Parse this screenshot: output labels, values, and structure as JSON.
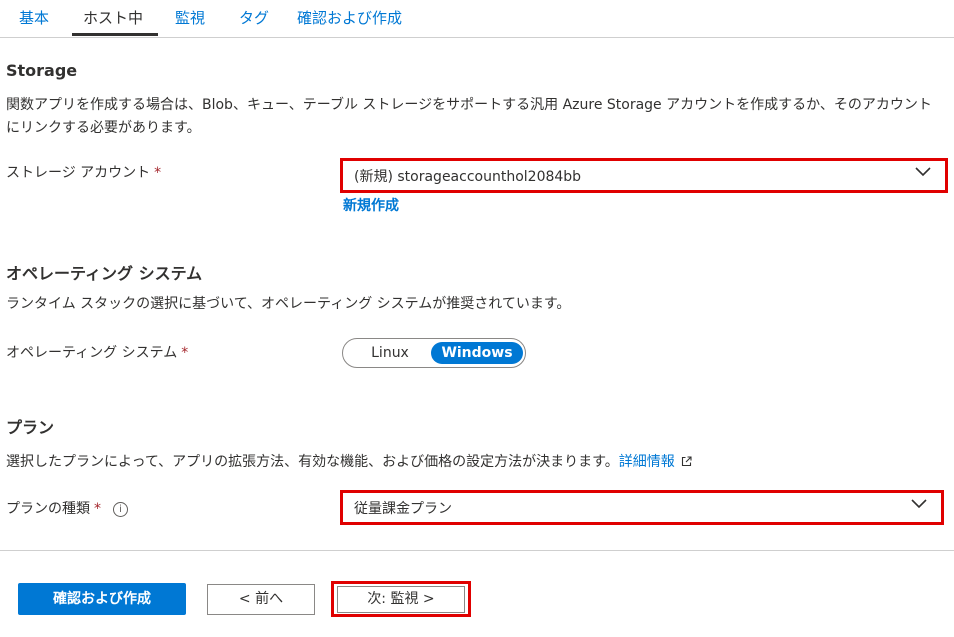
{
  "tabs": [
    {
      "label": "基本",
      "active": false
    },
    {
      "label": "ホスト中",
      "active": true
    },
    {
      "label": "監視",
      "active": false
    },
    {
      "label": "タグ",
      "active": false
    },
    {
      "label": "確認および作成",
      "active": false
    }
  ],
  "storage": {
    "title": "Storage",
    "description_line1": "関数アプリを作成する場合は、Blob、キュー、テーブル ストレージをサポートする汎用 Azure Storage アカウントを作成するか、そのアカウント",
    "description_line2": "にリンクする必要があります。",
    "account_label": "ストレージ アカウント",
    "required_mark": "*",
    "account_value": "(新規) storageaccounthol2084bb",
    "create_new_link": "新規作成"
  },
  "os": {
    "title": "オペレーティング システム",
    "description": "ランタイム スタックの選択に基づいて、オペレーティング システムが推奨されています。",
    "label": "オペレーティング システム",
    "required_mark": "*",
    "options": [
      "Linux",
      "Windows"
    ],
    "selected": "Windows"
  },
  "plan": {
    "title": "プラン",
    "description": "選択したプランによって、アプリの拡張方法、有効な機能、および価格の設定方法が決まります。",
    "learn_more_link": "詳細情報",
    "type_label": "プランの種類",
    "required_mark": "*",
    "info_icon": "i",
    "type_value": "従量課金プラン"
  },
  "footer": {
    "review_create_button": "確認および作成",
    "prev_button": "< 前へ",
    "next_button": "次: 監視 >"
  },
  "colors": {
    "accent": "#0078d4",
    "highlight_border": "#e00000",
    "required": "#a4262c"
  }
}
